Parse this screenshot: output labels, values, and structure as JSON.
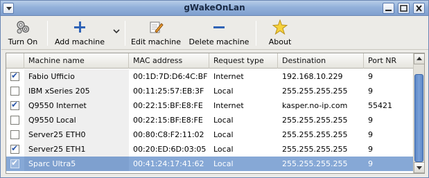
{
  "window": {
    "title": "gWakeOnLan"
  },
  "toolbar": {
    "turn_on": "Turn On",
    "add_machine": "Add machine",
    "edit_machine": "Edit machine",
    "delete_machine": "Delete machine",
    "about": "About"
  },
  "table": {
    "columns": [
      "Machine name",
      "MAC address",
      "Request type",
      "Destination",
      "Port NR"
    ],
    "rows": [
      {
        "checked": true,
        "name": "Fabio Ufficio",
        "mac": "00:1D:7D:D6:4C:BF",
        "type": "Internet",
        "dest": "192.168.10.229",
        "port": "9"
      },
      {
        "checked": false,
        "name": "IBM xSeries 205",
        "mac": "00:11:25:57:EB:3F",
        "type": "Local",
        "dest": "255.255.255.255",
        "port": "9"
      },
      {
        "checked": true,
        "name": "Q9550 Internet",
        "mac": "00:22:15:BF:E8:FE",
        "type": "Internet",
        "dest": "kasper.no-ip.com",
        "port": "55421"
      },
      {
        "checked": false,
        "name": "Q9550 Local",
        "mac": "00:22:15:BF:E8:FE",
        "type": "Local",
        "dest": "255.255.255.255",
        "port": "9"
      },
      {
        "checked": false,
        "name": "Server25 ETH0",
        "mac": "00:80:C8:F2:11:02",
        "type": "Local",
        "dest": "255.255.255.255",
        "port": "9"
      },
      {
        "checked": true,
        "name": "Server25 ETH1",
        "mac": "00:20:ED:6D:03:05",
        "type": "Local",
        "dest": "255.255.255.255",
        "port": "9"
      },
      {
        "checked": true,
        "name": "Sparc Ultra5",
        "mac": "00:41:24:17:41:62",
        "type": "Local",
        "dest": "255.255.255.255",
        "port": "9",
        "selected": true
      }
    ]
  },
  "colors": {
    "selection": "#86a8d6",
    "titlebar": "#93b1da",
    "icon_blue": "#2f63b6"
  },
  "icons": {
    "window_menu": "window-menu-icon",
    "minimize": "minimize-icon",
    "maximize": "maximize-icon",
    "close": "close-icon",
    "turn_on": "gears-icon",
    "add": "plus-icon",
    "add_menu": "chevron-down-icon",
    "edit": "edit-pencil-icon",
    "delete": "minus-icon",
    "about": "star-icon"
  }
}
